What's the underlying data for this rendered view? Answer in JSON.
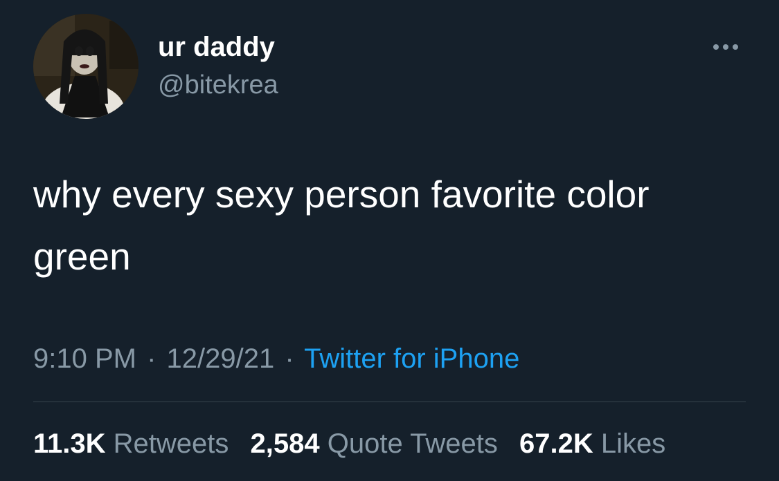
{
  "user": {
    "display_name": "ur daddy",
    "handle": "@bitekrea"
  },
  "more_icon": "more-horizontal-icon",
  "tweet": {
    "text": "why every sexy person favorite color\ngreen"
  },
  "meta": {
    "time": "9:10 PM",
    "separator": "·",
    "date": "12/29/21",
    "source": "Twitter for iPhone"
  },
  "stats": {
    "retweets_count": "11.3K",
    "retweets_label": "Retweets",
    "quotes_count": "2,584",
    "quotes_label": "Quote Tweets",
    "likes_count": "67.2K",
    "likes_label": "Likes"
  },
  "colors": {
    "background": "#15202b",
    "text_primary": "#ffffff",
    "text_secondary": "#8899a6",
    "link": "#1da1f2",
    "divider": "#38444d"
  }
}
